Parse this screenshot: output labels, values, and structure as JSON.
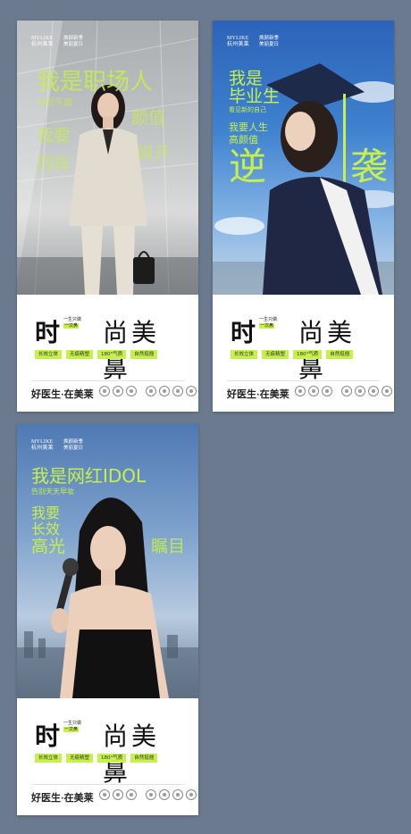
{
  "background_color": "#6b7a8f",
  "accent_color": "#c6f04a",
  "posters": [
    {
      "brand_line1": "MYLIKE",
      "brand_line2": "杭州美莱",
      "campaign_line1": "焕颜新季",
      "campaign_line2": "美丽夏日",
      "headline_lines": [
        "我是职场人",
        "告别平庸",
        "我要",
        "颜值",
        "同样",
        "飒开"
      ],
      "title_big": "时",
      "title_small_line1": "一生只做",
      "title_small_line2": "一次鼻",
      "title_rest": "尚美鼻",
      "tags": [
        "长效立体",
        "无痕精塑",
        "180°气质",
        "自然挺翘"
      ],
      "footer_logo": "好医生·在美莱",
      "footer_icons": [
        "cert-icon",
        "cert-icon",
        "cert-icon",
        "cert-icon",
        "cert-icon",
        "cert-icon",
        "cert-icon"
      ]
    },
    {
      "brand_line1": "MYLIKE",
      "brand_line2": "杭州美莱",
      "campaign_line1": "焕颜新季",
      "campaign_line2": "美丽夏日",
      "headline_lines": [
        "我是",
        "毕业生",
        "看见新的自己",
        "我要人生",
        "高颜值",
        "逆",
        "袭"
      ],
      "title_big": "时",
      "title_small_line1": "一生只做",
      "title_small_line2": "一次鼻",
      "title_rest": "尚美鼻",
      "tags": [
        "长效立体",
        "无痕精塑",
        "180°气质",
        "自然挺翘"
      ],
      "footer_logo": "好医生·在美莱",
      "footer_icons": [
        "cert-icon",
        "cert-icon",
        "cert-icon",
        "cert-icon",
        "cert-icon",
        "cert-icon",
        "cert-icon"
      ]
    },
    {
      "brand_line1": "MYLIKE",
      "brand_line2": "杭州美莱",
      "campaign_line1": "焕颜新季",
      "campaign_line2": "美丽夏日",
      "headline_lines": [
        "我是网红IDOL",
        "告别天天早妆",
        "我要",
        "长效",
        "高光",
        "瞩目"
      ],
      "title_big": "时",
      "title_small_line1": "一生只做",
      "title_small_line2": "一次鼻",
      "title_rest": "尚美鼻",
      "tags": [
        "长效立体",
        "无痕精塑",
        "180°气质",
        "自然挺翘"
      ],
      "footer_logo": "好医生·在美莱",
      "footer_icons": [
        "cert-icon",
        "cert-icon",
        "cert-icon",
        "cert-icon",
        "cert-icon",
        "cert-icon",
        "cert-icon"
      ]
    }
  ]
}
